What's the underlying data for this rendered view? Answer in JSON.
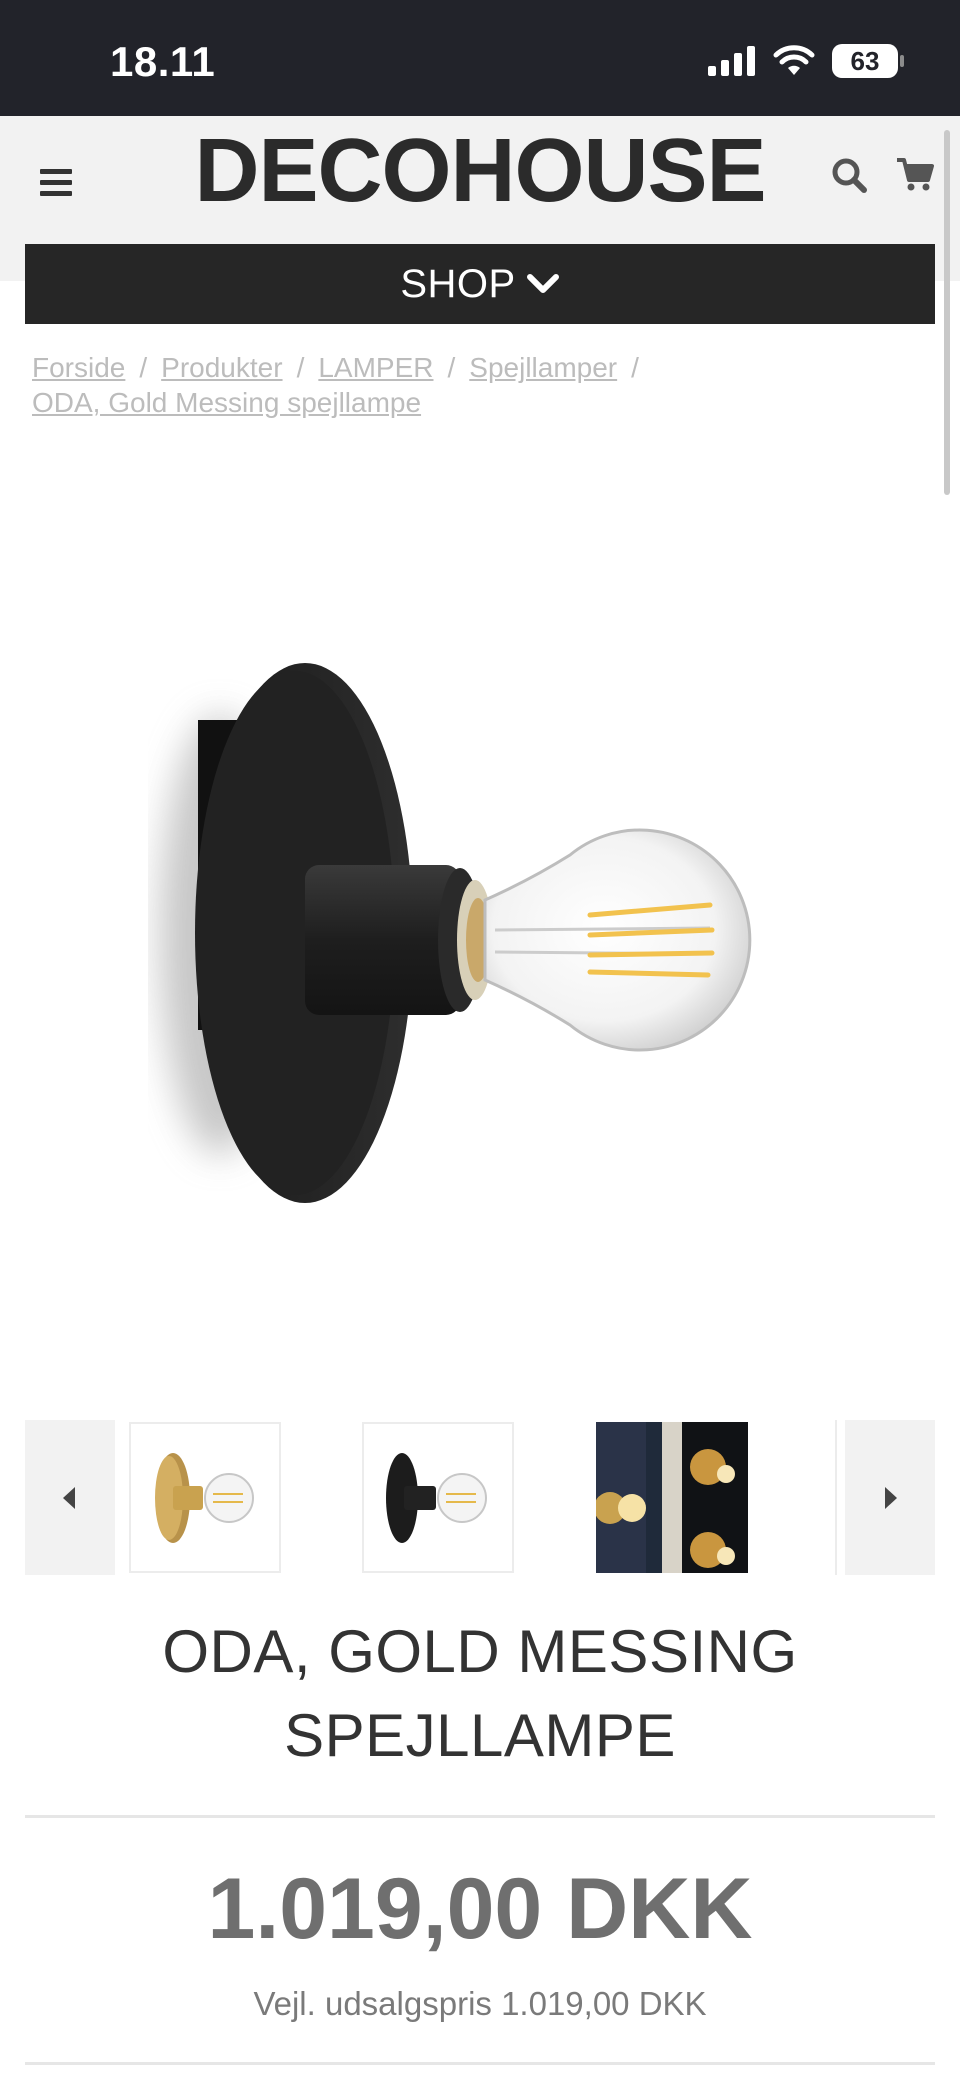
{
  "status_bar": {
    "time": "18.11",
    "battery": "63"
  },
  "header": {
    "logo": "DECOHOUSE",
    "shop_label": "SHOP"
  },
  "breadcrumb": [
    {
      "label": "Forside"
    },
    {
      "label": "Produkter"
    },
    {
      "label": "LAMPER"
    },
    {
      "label": "Spejllamper"
    },
    {
      "label": "ODA, Gold Messing spejllampe"
    }
  ],
  "breadcrumb_separator": "/",
  "product": {
    "title_line1": "ODA, GOLD MESSING",
    "title_line2": "SPEJLLAMPE",
    "price": "1.019,00 DKK",
    "rrp": "Vejl. udsalgspris 1.019,00 DKK"
  },
  "gallery": {
    "thumbnails": [
      "brass-lamp-thumbnail",
      "black-lamp-thumbnail",
      "interior-photo-thumbnail"
    ]
  },
  "colors": {
    "header_bg": "#f2f2f2",
    "status_bg": "#22232a",
    "shop_bar": "#262626",
    "price": "#6f6f6f"
  }
}
